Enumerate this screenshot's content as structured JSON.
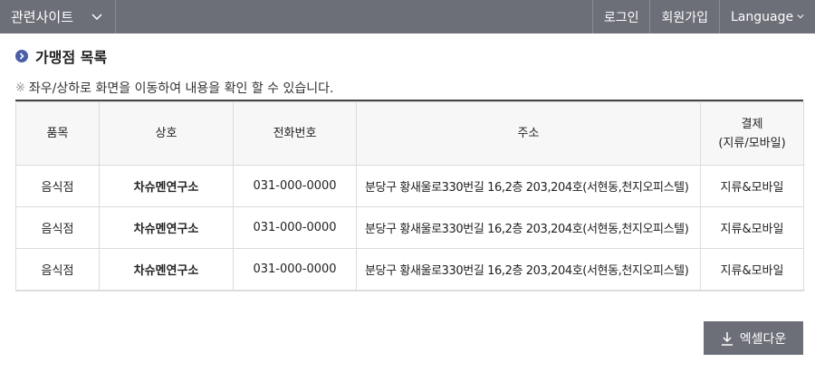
{
  "topbar": {
    "related_sites": "관련사이트",
    "login": "로그인",
    "signup": "회원가입",
    "language": "Language"
  },
  "section": {
    "title": "가맹점 목록",
    "notice_mark": "※",
    "notice": "좌우/상하로 화면을 이동하여 내용을 확인 할 수 있습니다."
  },
  "table": {
    "headers": {
      "category": "품목",
      "name": "상호",
      "phone": "전화번호",
      "address": "주소",
      "payment_line1": "결제",
      "payment_line2": "(지류/모바일)"
    },
    "rows": [
      {
        "category": "음식점",
        "name": "차슈멘연구소",
        "phone": "031-000-0000",
        "address": "분당구 황새울로330번길 16,2층 203,204호(서현동,천지오피스텔)",
        "payment": "지류&모바일"
      },
      {
        "category": "음식점",
        "name": "차슈멘연구소",
        "phone": "031-000-0000",
        "address": "분당구 황새울로330번길 16,2층 203,204호(서현동,천지오피스텔)",
        "payment": "지류&모바일"
      },
      {
        "category": "음식점",
        "name": "차슈멘연구소",
        "phone": "031-000-0000",
        "address": "분당구 황새울로330번길 16,2층 203,204호(서현동,천지오피스텔)",
        "payment": "지류&모바일"
      }
    ]
  },
  "excel_download": "엑셀다운",
  "colors": {
    "topbar_bg": "#6d6f78",
    "bullet": "#4a5fa8",
    "table_border_top": "#444444",
    "header_bg": "#f7f7f7"
  },
  "icons": {
    "dropdown": "chevron-down-icon",
    "bullet": "circle-arrow-icon",
    "download": "download-icon"
  }
}
